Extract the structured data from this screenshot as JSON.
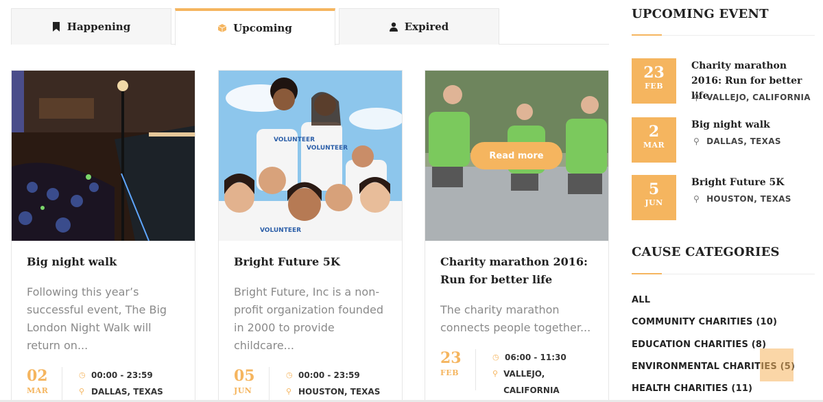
{
  "tabs": [
    {
      "label": "Happening",
      "icon": "bookmark-icon"
    },
    {
      "label": "Upcoming",
      "icon": "box-icon"
    },
    {
      "label": "Expired",
      "icon": "user-icon"
    }
  ],
  "cards": [
    {
      "title": "Big night walk",
      "excerpt": "Following this year’s successful event, The Big London Night Walk will return on...",
      "day": "02",
      "month": "MAR",
      "time": "00:00 - 23:59",
      "location": "DALLAS, TEXAS"
    },
    {
      "title": "Bright Future 5K",
      "excerpt": "Bright Future, Inc is a non-profit organization founded in 2000 to provide childcare...",
      "day": "05",
      "month": "JUN",
      "time": "00:00 - 23:59",
      "location": "HOUSTON, TEXAS"
    },
    {
      "title": "Charity marathon 2016: Run for better life",
      "excerpt": "The charity marathon connects people together...",
      "day": "23",
      "month": "FEB",
      "time": "06:00 - 11:30",
      "location": "VALLEJO, CALIFORNIA",
      "read_more": "Read more"
    }
  ],
  "sidebar": {
    "upcoming_title": "UPCOMING EVENT",
    "events": [
      {
        "day": "23",
        "month": "FEB",
        "title": "Charity marathon 2016: Run for better life",
        "location": "VALLEJO, CALIFORNIA"
      },
      {
        "day": "2",
        "month": "MAR",
        "title": "Big night walk",
        "location": "DALLAS, TEXAS"
      },
      {
        "day": "5",
        "month": "JUN",
        "title": "Bright Future 5K",
        "location": "HOUSTON, TEXAS"
      }
    ],
    "categories_title": "CAUSE CATEGORIES",
    "categories": [
      "ALL",
      "COMMUNITY CHARITIES (10)",
      "EDUCATION CHARITIES (8)",
      "ENVIRONMENTAL CHARITIES (5)",
      "HEALTH CHARITIES (11)"
    ]
  },
  "colors": {
    "accent": "#f5b55f",
    "text": "#222222",
    "muted": "#8a8a8a"
  }
}
